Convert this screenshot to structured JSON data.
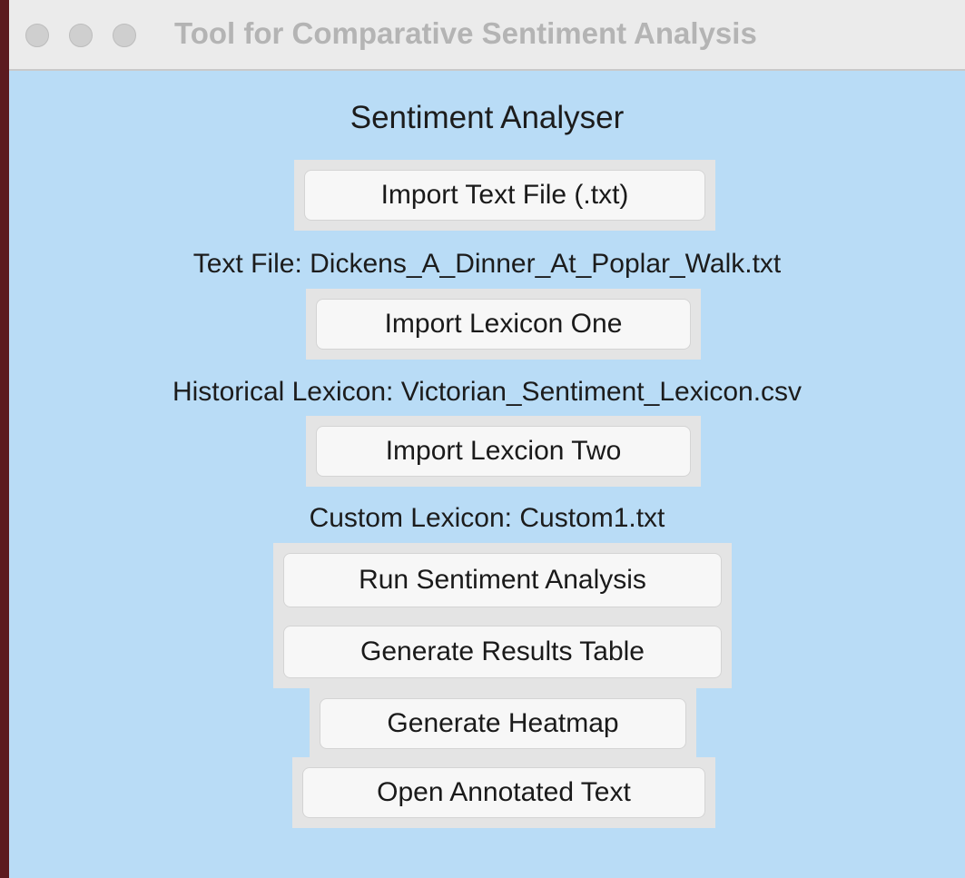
{
  "window": {
    "title": "Tool for Comparative Sentiment Analysis"
  },
  "main": {
    "heading": "Sentiment Analyser",
    "buttons": {
      "import_text": "Import Text File (.txt)",
      "import_lexicon_one": "Import Lexicon One",
      "import_lexicon_two": "Import Lexcion Two",
      "run_analysis": "Run Sentiment Analysis",
      "results_table": "Generate Results Table",
      "heatmap": "Generate Heatmap",
      "annotated_text": "Open Annotated Text"
    },
    "status": {
      "text_file": "Text File: Dickens_A_Dinner_At_Poplar_Walk.txt",
      "lexicon_one": "Historical Lexicon: Victorian_Sentiment_Lexicon.csv",
      "lexicon_two": "Custom Lexicon: Custom1.txt"
    }
  }
}
